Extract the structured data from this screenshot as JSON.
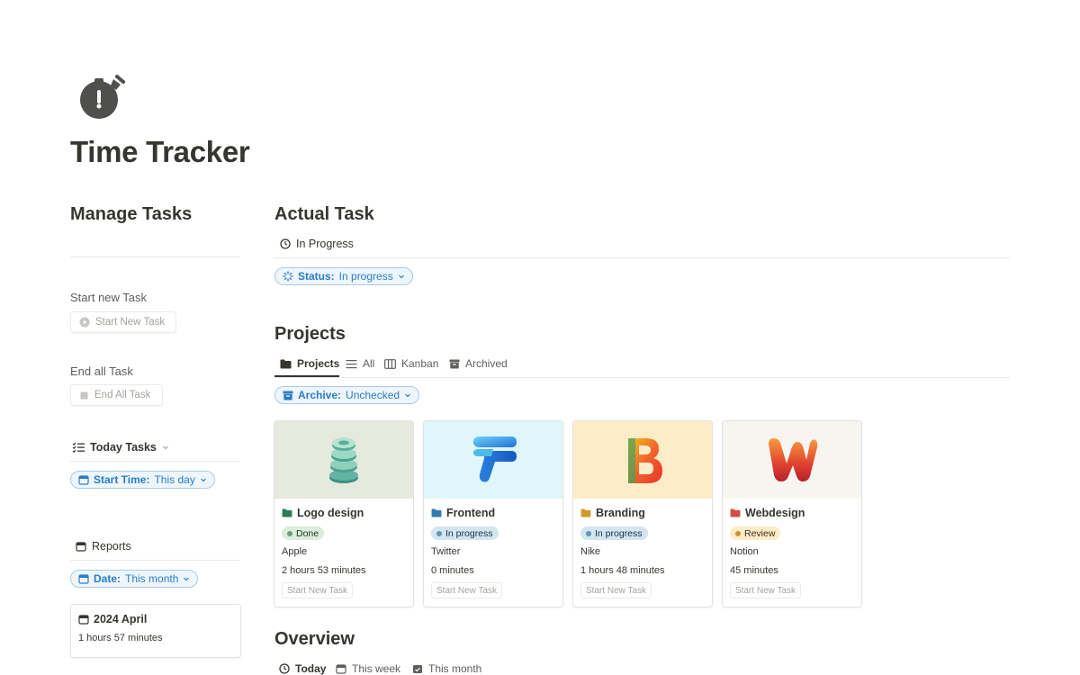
{
  "page": {
    "title": "Time Tracker",
    "icon": "stopwatch-icon"
  },
  "sidebar": {
    "heading": "Manage Tasks",
    "start_label": "Start new Task",
    "start_button": "Start New Task",
    "end_label": "End all Task",
    "end_button": "End All Task",
    "today": {
      "view_title": "Today Tasks",
      "filter_prop": "Start Time:",
      "filter_value": "This day"
    },
    "reports": {
      "view_title": "Reports",
      "filter_prop": "Date:",
      "filter_value": "This month",
      "card_title": "2024 April",
      "card_value": "1 hours 57 minutes"
    }
  },
  "actual": {
    "heading": "Actual Task",
    "view_title": "In Progress",
    "filter_prop": "Status:",
    "filter_value": "In progress"
  },
  "projects": {
    "heading": "Projects",
    "tabs": [
      {
        "label": "Projects",
        "icon": "folder-icon"
      },
      {
        "label": "All",
        "icon": "list-icon"
      },
      {
        "label": "Kanban",
        "icon": "board-icon"
      },
      {
        "label": "Archived",
        "icon": "archive-icon"
      }
    ],
    "filter_prop": "Archive:",
    "filter_value": "Unchecked",
    "cards": [
      {
        "title": "Logo design",
        "status": "Done",
        "client": "Apple",
        "time": "2 hours 53 minutes",
        "button": "Start New Task",
        "folder_color": "#2f7d55",
        "status_bg": "#dbeddb",
        "status_dot": "#6c9b7d",
        "status_color": "#1c3829",
        "cover_bg": "#e5e9de"
      },
      {
        "title": "Frontend",
        "status": "In progress",
        "client": "Twitter",
        "time": "0 minutes",
        "button": "Start New Task",
        "folder_color": "#2f7bb0",
        "status_bg": "#d3e5ef",
        "status_dot": "#5b97bd",
        "status_color": "#183347",
        "cover_bg": "#dff6fa"
      },
      {
        "title": "Branding",
        "status": "In progress",
        "client": "Nike",
        "time": "1 hours 48 minutes",
        "button": "Start New Task",
        "folder_color": "#d09a2c",
        "status_bg": "#d3e5ef",
        "status_dot": "#5b97bd",
        "status_color": "#183347",
        "cover_bg": "#fdecc8"
      },
      {
        "title": "Webdesign",
        "status": "Review",
        "client": "Notion",
        "time": "45 minutes",
        "button": "Start New Task",
        "folder_color": "#d44c47",
        "status_bg": "#fdecc8",
        "status_dot": "#cb912f",
        "status_color": "#402c1b",
        "cover_bg": "#f6f5ef"
      }
    ]
  },
  "overview": {
    "heading": "Overview",
    "tabs": [
      {
        "label": "Today",
        "icon": "clock-icon"
      },
      {
        "label": "This week",
        "icon": "calendar-icon"
      },
      {
        "label": "This month",
        "icon": "calendar-check-icon"
      }
    ]
  },
  "colors": {
    "accent": "#2a7cc7",
    "text": "#37352f",
    "muted": "#a5a29c"
  }
}
